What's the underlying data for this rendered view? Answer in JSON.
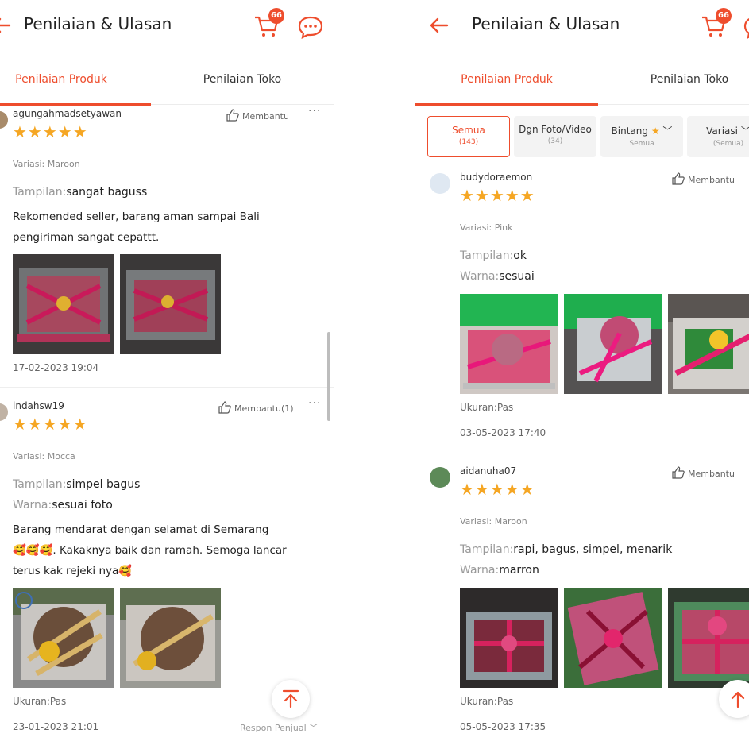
{
  "header": {
    "title": "Penilaian & Ulasan",
    "cart_count": "66",
    "icons": [
      "back-arrow-icon",
      "cart-icon",
      "chat-icon"
    ]
  },
  "tabs": [
    "Penilaian Produk",
    "Penilaian Toko"
  ],
  "filters": [
    {
      "label": "Semua",
      "sub": "(143)"
    },
    {
      "label": "Dgn Foto/Video",
      "sub": "(34)"
    },
    {
      "label": "Bintang",
      "sub": "Semua"
    },
    {
      "label": "Variasi",
      "sub": "(Semua)"
    }
  ],
  "left_reviews": [
    {
      "user": "agungahmadsetyawan",
      "helpful": "Membantu",
      "rating": 5,
      "variant": "Variasi: Maroon",
      "attrs": [
        {
          "k": "Tampilan:",
          "v": "sangat baguss"
        }
      ],
      "text": "Rekomended seller,  barang aman sampai Bali pengiriman sangat cepattt.",
      "date": "17-02-2023 19:04"
    },
    {
      "user": "indahsw19",
      "helpful": "Membantu(1)",
      "rating": 5,
      "variant": "Variasi: Mocca",
      "attrs": [
        {
          "k": "Tampilan:",
          "v": "simpel bagus"
        },
        {
          "k": "Warna:",
          "v": "sesuai foto"
        }
      ],
      "text_lines": [
        "Barang mendarat dengan selamat di Semarang",
        "🥰🥰🥰. Kakaknya baik dan ramah.  Semoga lancar",
        "terus kak rejeki nya🥰"
      ],
      "size": "Ukuran:Pas",
      "date": "23-01-2023 21:01",
      "seller_response": "Respon Penjual"
    }
  ],
  "right_reviews": [
    {
      "user": "budydoraemon",
      "helpful": "Membantu",
      "rating": 5,
      "variant": "Variasi: Pink",
      "attrs": [
        {
          "k": "Tampilan:",
          "v": "ok"
        },
        {
          "k": "Warna:",
          "v": "sesuai"
        }
      ],
      "size": "Ukuran:Pas",
      "date": "03-05-2023 17:40"
    },
    {
      "user": "aidanuha07",
      "helpful": "Membantu",
      "rating": 5,
      "variant": "Variasi: Maroon",
      "attrs": [
        {
          "k": "Tampilan:",
          "v": "rapi, bagus, simpel, menarik"
        },
        {
          "k": "Warna:",
          "v": "marron"
        }
      ],
      "size": "Ukuran:Pas",
      "date": "05-05-2023 17:35"
    }
  ],
  "stars_text": "★★★★★",
  "more_text": "···",
  "colors": {
    "accent": "#ee4d2d",
    "star": "#f5a623"
  }
}
